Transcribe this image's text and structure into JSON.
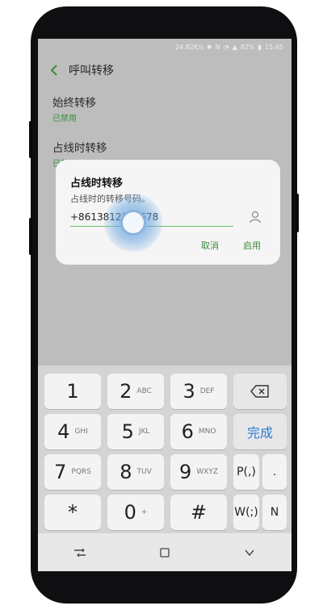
{
  "status": {
    "speed": "24.82K/s",
    "battery": "82%",
    "time": "15:45"
  },
  "header": {
    "title": "呼叫转移"
  },
  "items": [
    {
      "name": "始终转移",
      "status": "已禁用"
    },
    {
      "name": "占线时转移",
      "status": "已禁用"
    }
  ],
  "dialog": {
    "title": "占线时转移",
    "subtitle": "占线时的转移号码。",
    "number": "+8613812345678",
    "cancel": "取消",
    "ok": "启用"
  },
  "keyboard": {
    "row1": [
      {
        "num": "1",
        "letters": ""
      },
      {
        "num": "2",
        "letters": "ABC"
      },
      {
        "num": "3",
        "letters": "DEF"
      }
    ],
    "row2": [
      {
        "num": "4",
        "letters": "GHI"
      },
      {
        "num": "5",
        "letters": "JKL"
      },
      {
        "num": "6",
        "letters": "MNO"
      }
    ],
    "row3": [
      {
        "num": "7",
        "letters": "PQRS"
      },
      {
        "num": "8",
        "letters": "TUV"
      },
      {
        "num": "9",
        "letters": "WXYZ"
      }
    ],
    "row4": [
      {
        "num": "*",
        "letters": ""
      },
      {
        "num": "0",
        "letters": "+"
      },
      {
        "num": "#",
        "letters": ""
      }
    ],
    "done": "完成",
    "pause": "P(,)",
    "dot": ".",
    "wait": "W(;)",
    "n": "N"
  }
}
